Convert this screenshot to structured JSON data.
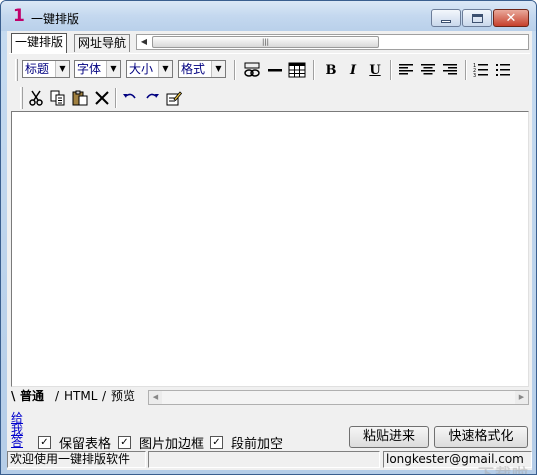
{
  "window": {
    "logo": "1",
    "title": "一键排版"
  },
  "tabs": [
    {
      "label": "一键排版",
      "active": true
    },
    {
      "label": "网址导航",
      "active": false
    }
  ],
  "toolbar": {
    "selects": [
      {
        "label": "标题"
      },
      {
        "label": "字体"
      },
      {
        "label": "大小"
      },
      {
        "label": "格式"
      }
    ],
    "bold_label": "B",
    "italic_label": "I",
    "underline_label": "U"
  },
  "editor": {
    "content": ""
  },
  "mode_tabs": [
    {
      "label": "普通",
      "active": true
    },
    {
      "label": "HTML",
      "active": false
    },
    {
      "label": "预览",
      "active": false
    }
  ],
  "options": {
    "vertical_link": "给我答",
    "checkboxes": [
      {
        "label": "保留表格",
        "checked": true
      },
      {
        "label": "图片加边框",
        "checked": true
      },
      {
        "label": "段前加空",
        "checked": true
      }
    ],
    "paste_button": "粘贴进来",
    "format_button": "快速格式化"
  },
  "status": {
    "welcome": "欢迎使用一键排版软件",
    "email": "longkester@gmail.com",
    "watermark": "下载啦"
  },
  "colors": {
    "logo": "#c0006a",
    "link": "#0000cc",
    "select_text": "#000080",
    "close_button": "#c7402b"
  }
}
